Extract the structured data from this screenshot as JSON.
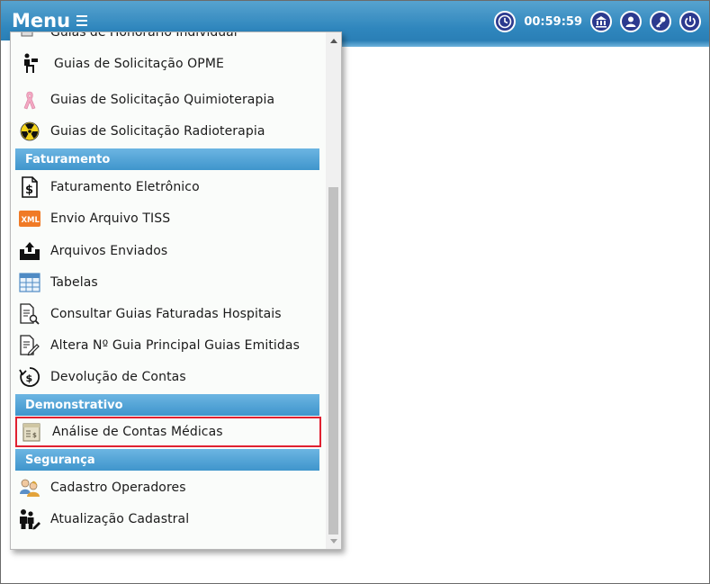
{
  "header": {
    "menu_label": "Menu",
    "timer": "00:59:59",
    "icons": [
      "clock-icon",
      "bank-icon",
      "user-icon",
      "key-icon",
      "power-icon"
    ]
  },
  "menu": {
    "partial_item": "Guias de Honorário Individual",
    "items_top": [
      {
        "label": "Guias de Solicitação OPME",
        "icon": "opme-icon"
      },
      {
        "label": "Guias de Solicitação Quimioterapia",
        "icon": "pink-ribbon-icon"
      },
      {
        "label": "Guias de Solicitação Radioterapia",
        "icon": "radiation-icon"
      }
    ],
    "sections": [
      {
        "title": "Faturamento",
        "items": [
          {
            "label": "Faturamento Eletrônico",
            "icon": "dollar-document-icon"
          },
          {
            "label": "Envio Arquivo TISS",
            "icon": "xml-icon"
          },
          {
            "label": "Arquivos Enviados",
            "icon": "upload-tray-icon"
          },
          {
            "label": "Tabelas",
            "icon": "table-icon"
          },
          {
            "label": "Consultar Guias Faturadas Hospitais",
            "icon": "search-document-icon"
          },
          {
            "label": "Altera Nº Guia Principal Guias Emitidas",
            "icon": "edit-document-icon"
          },
          {
            "label": "Devolução de Contas",
            "icon": "money-return-icon"
          }
        ]
      },
      {
        "title": "Demonstrativo",
        "items": [
          {
            "label": "Análise de Contas Médicas",
            "icon": "statement-icon",
            "highlighted": true
          }
        ]
      },
      {
        "title": "Segurança",
        "items": [
          {
            "label": "Cadastro Operadores",
            "icon": "operators-icon"
          },
          {
            "label": "Atualização Cadastral",
            "icon": "people-edit-icon"
          }
        ]
      }
    ]
  },
  "colors": {
    "topbar": "#2f86bd",
    "section_header": "#4a9dd2",
    "highlight_border": "#e02030",
    "icon_circle": "#2c3a8f"
  }
}
